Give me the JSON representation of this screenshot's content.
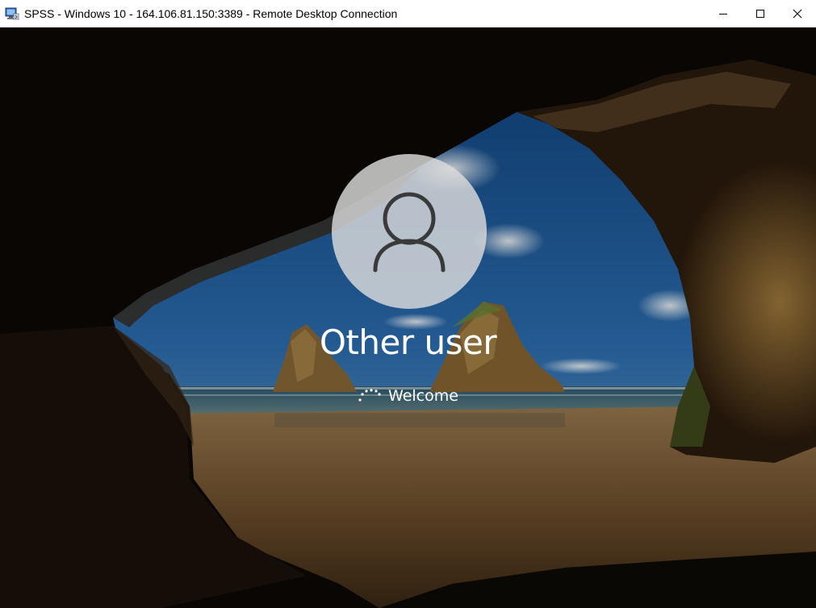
{
  "window": {
    "title": "SPSS - Windows 10 - 164.106.81.150:3389 - Remote Desktop Connection",
    "app_icon": "remote-desktop-icon",
    "controls": [
      "minimize-icon",
      "maximize-icon",
      "close-icon"
    ]
  },
  "login": {
    "avatar_icon": "user-silhouette-icon",
    "user_name": "Other user",
    "status": "Welcome",
    "spinner_icon": "loading-spinner-icon"
  },
  "colors": {
    "titlebar": "#ffffff",
    "sky": "#1f5fa0",
    "sand": "#8a6a3c",
    "rock": "#2a1c10",
    "text": "#ffffff"
  }
}
